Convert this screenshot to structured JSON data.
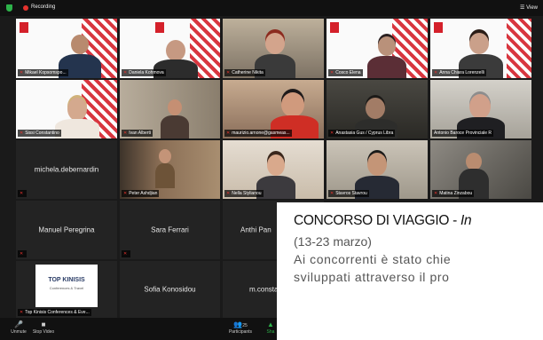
{
  "topbar": {
    "recording_label": "Recording",
    "view_label": "View"
  },
  "tiles": [
    {
      "name": "Mikael Kopsomspo..."
    },
    {
      "name": "Daniela Kohmova"
    },
    {
      "name": "Catherine Nikita"
    },
    {
      "name": "Cosco Elena"
    },
    {
      "name": "Anna Chiara Lorenzelli"
    },
    {
      "name": "Sissi Constantino"
    },
    {
      "name": "Ivan Alberti"
    },
    {
      "name": "maurizio.arnone@gasmeas..."
    },
    {
      "name": "Anastasia Gus / Cyprus Libra"
    },
    {
      "name": "Antonio Baroce Provinciale R"
    },
    {
      "name": "michela.debernardin"
    },
    {
      "name": "Peter Ashdjian"
    },
    {
      "name": "Nella Stylianou"
    },
    {
      "name": "Stavros Stavrou"
    },
    {
      "name": "Matina Zinzabou"
    },
    {
      "name": "Manuel Peregrina"
    },
    {
      "name": "Sara Ferrari"
    },
    {
      "name": "Anthi Pan"
    },
    {
      "name": "Top Kinisis Conferences & Eve..."
    },
    {
      "name": "Sofia Konosidou"
    },
    {
      "name": "m.consta"
    }
  ],
  "logo_tile": {
    "line1": "TOP KINISIS",
    "line2": "Conferences & Travel"
  },
  "overlay": {
    "title_main": "CONCORSO DI VIAGGIO - ",
    "title_italic": "In",
    "dates": "(13-23 marzo)",
    "text_line": "Ai concorrenti è stato chie",
    "text_line2": "sviluppati attraverso il pro"
  },
  "bottombar": {
    "unmute": "Unmute",
    "stop_video": "Stop Video",
    "participants": "Participants",
    "participants_count": "25",
    "share": "Sha"
  },
  "colors": {
    "active_border": "#9ccc2f",
    "mic_muted": "#e5322d",
    "banner_red": "#d4202a"
  }
}
